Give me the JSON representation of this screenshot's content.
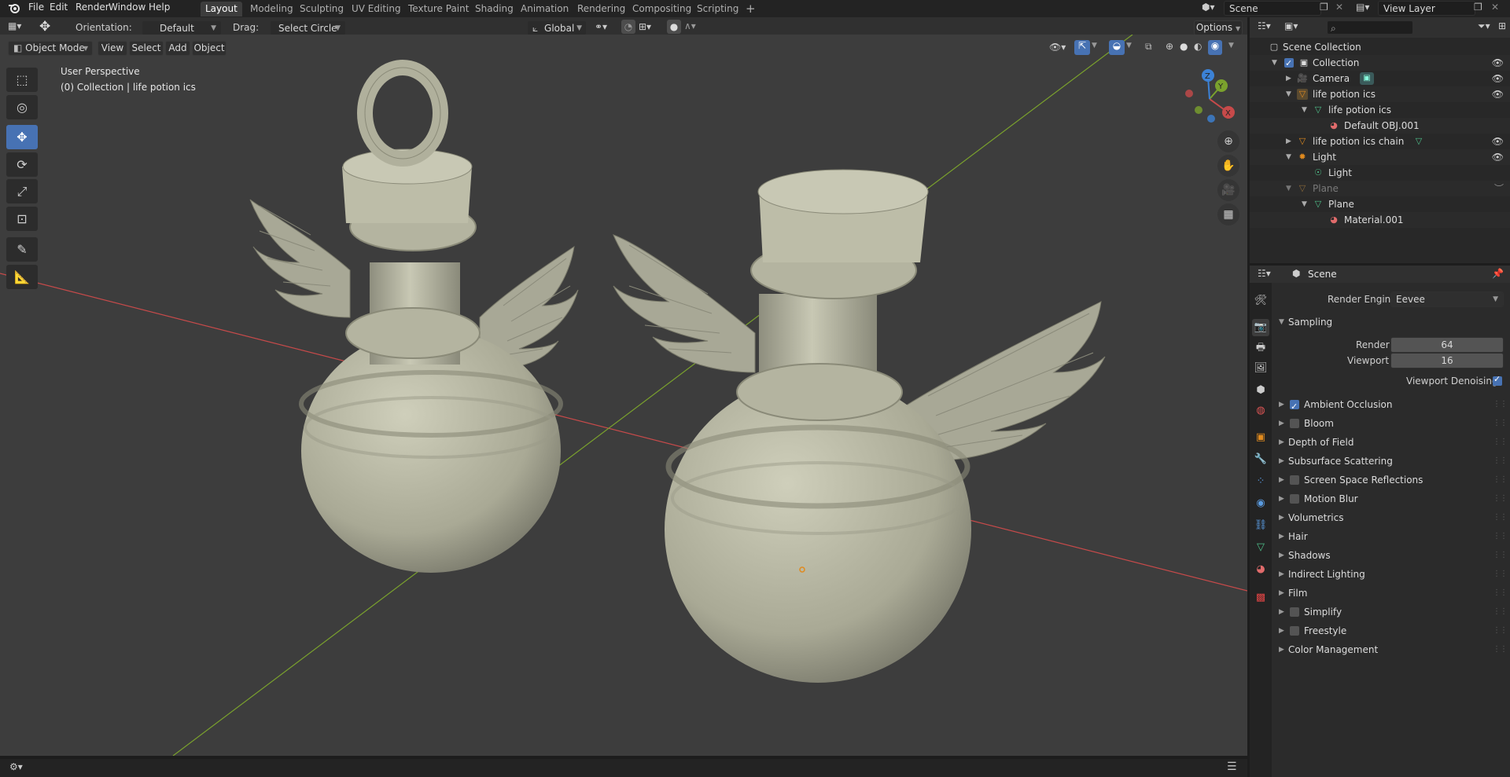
{
  "app": {
    "title": "Blender"
  },
  "menus": [
    "File",
    "Edit",
    "Render",
    "Window",
    "Help"
  ],
  "workspaces": [
    "Layout",
    "Modeling",
    "Sculpting",
    "UV Editing",
    "Texture Paint",
    "Shading",
    "Animation",
    "Rendering",
    "Compositing",
    "Scripting"
  ],
  "active_workspace": "Layout",
  "add_tab": "+",
  "scene": {
    "name": "Scene"
  },
  "view_layer": {
    "name": "View Layer"
  },
  "tool_header": {
    "orientation_label": "Orientation:",
    "orientation_value": "Default",
    "drag_label": "Drag:",
    "drag_value": "Select Circle",
    "transform_orientation": "Global",
    "options_label": "Options"
  },
  "viewport_header": {
    "mode": "Object Mode",
    "view": "View",
    "select": "Select",
    "add": "Add",
    "object": "Object"
  },
  "viewport": {
    "perspective_label": "User Perspective",
    "collection_label": "(0) Collection | life potion ics",
    "gizmo": {
      "x": "X",
      "y": "Y",
      "z": "Z"
    },
    "floor_color": "#3d3d3d",
    "model_color": "#b8b8a4"
  },
  "outliner": {
    "root": "Scene Collection",
    "rows": [
      {
        "label": "Collection",
        "icon": "collection-icon"
      },
      {
        "label": "Camera",
        "icon": "camera-icon"
      },
      {
        "label": "life potion ics",
        "icon": "mesh-object-icon"
      },
      {
        "label": "life potion ics",
        "icon": "mesh-data-icon"
      },
      {
        "label": "Default OBJ.001",
        "icon": "material-icon"
      },
      {
        "label": "life potion ics chain",
        "icon": "mesh-object-icon"
      },
      {
        "label": "Light",
        "icon": "light-icon"
      },
      {
        "label": "Light",
        "icon": "light-data-icon"
      },
      {
        "label": "Plane",
        "icon": "mesh-object-icon"
      },
      {
        "label": "Plane",
        "icon": "mesh-data-icon"
      },
      {
        "label": "Material.001",
        "icon": "material-icon"
      }
    ]
  },
  "properties": {
    "context": "Scene",
    "render_engine_label": "Render Engine",
    "render_engine_value": "Eevee",
    "sampling_label": "Sampling",
    "render_label": "Render",
    "render_value": "64",
    "viewport_label": "Viewport",
    "viewport_value": "16",
    "viewport_denoising_label": "Viewport Denoising",
    "viewport_denoising": true,
    "sections": [
      {
        "label": "Ambient Occlusion",
        "checkbox": true,
        "checked": true
      },
      {
        "label": "Bloom",
        "checkbox": true,
        "checked": false
      },
      {
        "label": "Depth of Field",
        "checkbox": false
      },
      {
        "label": "Subsurface Scattering",
        "checkbox": false
      },
      {
        "label": "Screen Space Reflections",
        "checkbox": true,
        "checked": false
      },
      {
        "label": "Motion Blur",
        "checkbox": true,
        "checked": false
      },
      {
        "label": "Volumetrics",
        "checkbox": false
      },
      {
        "label": "Hair",
        "checkbox": false
      },
      {
        "label": "Shadows",
        "checkbox": false
      },
      {
        "label": "Indirect Lighting",
        "checkbox": false
      },
      {
        "label": "Film",
        "checkbox": false
      },
      {
        "label": "Simplify",
        "checkbox": true,
        "checked": false
      },
      {
        "label": "Freestyle",
        "checkbox": true,
        "checked": false
      },
      {
        "label": "Color Management",
        "checkbox": false
      }
    ]
  },
  "colors": {
    "accent": "#4772b3",
    "x_axis": "#c74a4a",
    "y_axis": "#7aa12d",
    "z_axis": "#3c82d6"
  }
}
